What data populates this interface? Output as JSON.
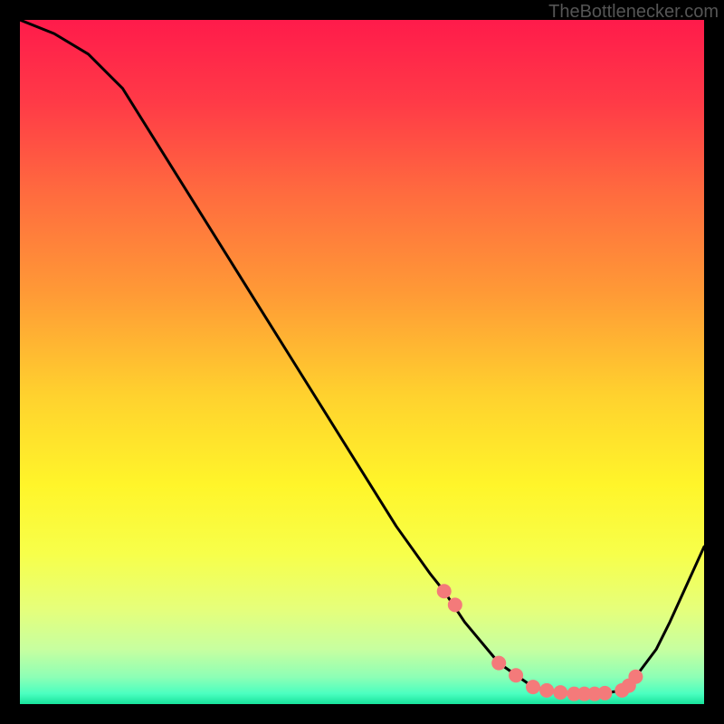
{
  "watermark": "TheBottlenecker.com",
  "chart_data": {
    "type": "line",
    "title": "",
    "xlabel": "",
    "ylabel": "",
    "xlim": [
      0,
      100
    ],
    "ylim": [
      0,
      100
    ],
    "curve": {
      "x": [
        0,
        5,
        10,
        15,
        20,
        25,
        30,
        35,
        40,
        45,
        50,
        55,
        60,
        62,
        65,
        70,
        75,
        80,
        85,
        88,
        90,
        93,
        95,
        100
      ],
      "y": [
        100,
        98,
        95,
        90,
        82,
        74,
        66,
        58,
        50,
        42,
        34,
        26,
        19,
        16.5,
        12,
        6,
        2.5,
        1.5,
        1.5,
        2,
        4,
        8,
        12,
        23
      ]
    },
    "markers": {
      "x": [
        62,
        63.6,
        70,
        72.5,
        75,
        77,
        79,
        81,
        82.5,
        84,
        85.5,
        88,
        89,
        90
      ],
      "y": [
        16.5,
        14.5,
        6,
        4.2,
        2.5,
        2.0,
        1.7,
        1.5,
        1.5,
        1.5,
        1.6,
        2,
        2.7,
        4
      ]
    },
    "gradient_stops": [
      {
        "offset": 0.0,
        "color": "#ff1b4b"
      },
      {
        "offset": 0.12,
        "color": "#ff3a47"
      },
      {
        "offset": 0.25,
        "color": "#ff6a3f"
      },
      {
        "offset": 0.4,
        "color": "#ff9a36"
      },
      {
        "offset": 0.55,
        "color": "#ffd22e"
      },
      {
        "offset": 0.68,
        "color": "#fff52a"
      },
      {
        "offset": 0.78,
        "color": "#f7ff4a"
      },
      {
        "offset": 0.86,
        "color": "#e6ff7a"
      },
      {
        "offset": 0.92,
        "color": "#c7ffa0"
      },
      {
        "offset": 0.96,
        "color": "#8effb5"
      },
      {
        "offset": 0.985,
        "color": "#4affc0"
      },
      {
        "offset": 1.0,
        "color": "#18e29b"
      }
    ],
    "marker_color": "#f47a7a",
    "line_color": "#000000"
  }
}
